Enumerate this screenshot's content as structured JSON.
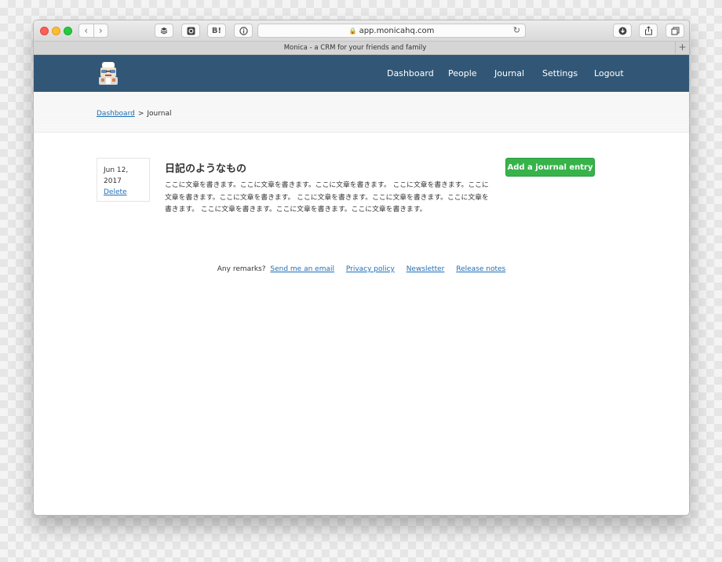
{
  "browser": {
    "url": "app.monicahq.com",
    "tab_title": "Monica - a CRM for your friends and family",
    "ext_b_label": "B!",
    "new_tab_label": "+"
  },
  "nav": {
    "items": [
      {
        "label": "Dashboard"
      },
      {
        "label": "People"
      },
      {
        "label": "Journal"
      },
      {
        "label": "Settings"
      },
      {
        "label": "Logout"
      }
    ]
  },
  "breadcrumb": {
    "home": "Dashboard",
    "separator": ">",
    "current": "Journal"
  },
  "entry": {
    "date_line1": "Jun 12,",
    "date_line2": "2017",
    "delete_label": "Delete",
    "title": "日記のようなもの",
    "body": "ここに文章を書きます。ここに文章を書きます。ここに文章を書きます。 ここに文章を書きます。ここに文章を書きます。ここに文章を書きます。 ここに文章を書きます。ここに文章を書きます。ここに文章を書きます。 ここに文章を書きます。ここに文章を書きます。ここに文章を書きます。"
  },
  "actions": {
    "add_entry_label": "Add a journal entry"
  },
  "footer": {
    "remarks": "Any remarks?",
    "links": [
      {
        "label": "Send me an email"
      },
      {
        "label": "Privacy policy"
      },
      {
        "label": "Newsletter"
      },
      {
        "label": "Release notes"
      }
    ]
  },
  "colors": {
    "nav_bg": "#325776",
    "accent_green": "#37b34a",
    "link": "#1f6fb5"
  }
}
